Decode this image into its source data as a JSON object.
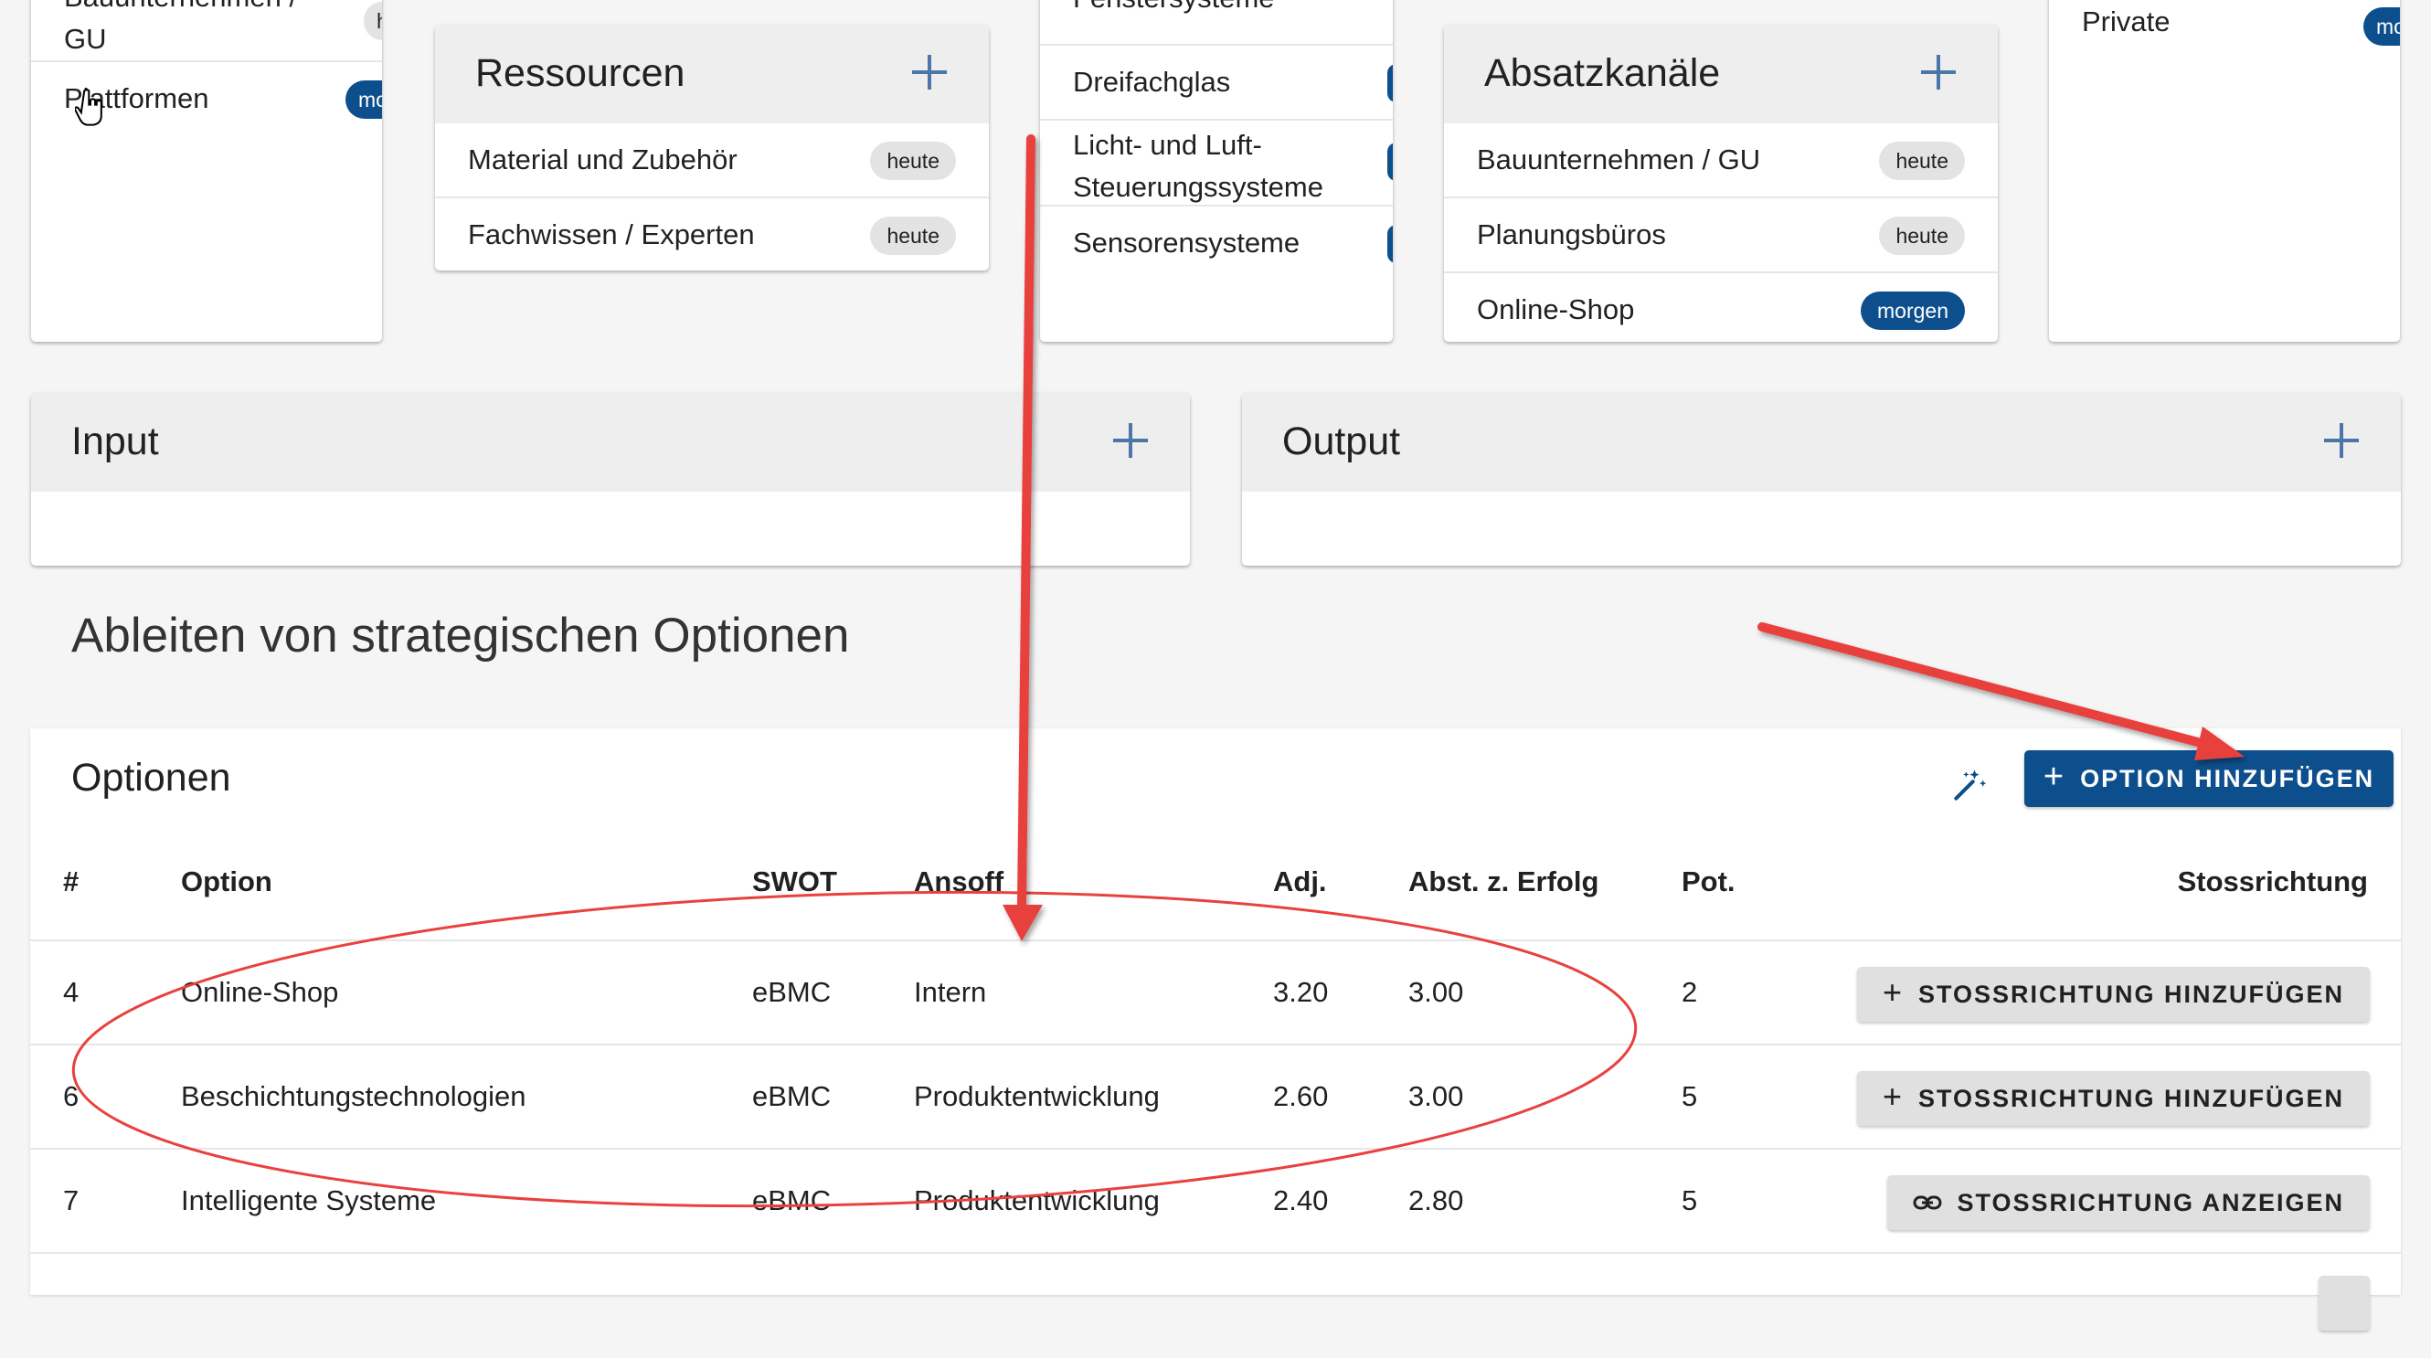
{
  "top_cards": {
    "partners": {
      "items": [
        {
          "label": "Bauunternehmen / GU",
          "chip": ""
        },
        {
          "label": "Plattformen",
          "chip": "morgen"
        }
      ]
    },
    "ressourcen": {
      "title": "Ressourcen",
      "items": [
        {
          "label": "Material und Zubehör",
          "chip": "heute"
        },
        {
          "label": "Fachwissen / Experten",
          "chip": "heute"
        }
      ]
    },
    "angebot": {
      "items": [
        {
          "label": "Fenstersysteme"
        },
        {
          "label": "Dreifachglas"
        },
        {
          "label": "Licht- und Luft-Steuerungssysteme"
        },
        {
          "label": "Sensorensysteme"
        }
      ]
    },
    "absatzkanaele": {
      "title": "Absatzkanäle",
      "items": [
        {
          "label": "Bauunternehmen / GU",
          "chip": "heute"
        },
        {
          "label": "Planungsbüros",
          "chip": "heute"
        },
        {
          "label": "Online-Shop",
          "chip": "morgen"
        }
      ]
    },
    "kunden": {
      "items": [
        {
          "label": "Private",
          "chip": "morgen"
        }
      ]
    }
  },
  "io_cards": {
    "input": {
      "title": "Input"
    },
    "output": {
      "title": "Output"
    }
  },
  "section": {
    "title": "Ableiten von strategischen Optionen"
  },
  "options": {
    "title": "Optionen",
    "add_button": "OPTION HINZUFÜGEN",
    "columns": [
      "#",
      "Option",
      "SWOT",
      "Ansoff",
      "Adj.",
      "Abst. z. Erfolg",
      "Pot.",
      "Stossrichtung"
    ],
    "rows": [
      {
        "num": "4",
        "option": "Online-Shop",
        "swot": "eBMC",
        "ansoff": "Intern",
        "adj": "3.20",
        "abst": "3.00",
        "pot": "2",
        "action": "STOSSRICHTUNG HINZUFÜGEN",
        "action_icon": "plus-icon"
      },
      {
        "num": "6",
        "option": "Beschichtungstechnologien",
        "swot": "eBMC",
        "ansoff": "Produktentwicklung",
        "adj": "2.60",
        "abst": "3.00",
        "pot": "5",
        "action": "STOSSRICHTUNG HINZUFÜGEN",
        "action_icon": "plus-icon"
      },
      {
        "num": "7",
        "option": "Intelligente Systeme",
        "swot": "eBMC",
        "ansoff": "Produktentwicklung",
        "adj": "2.40",
        "abst": "2.80",
        "pot": "5",
        "action": "STOSSRICHTUNG ANZEIGEN",
        "action_icon": "link-icon"
      }
    ]
  },
  "colors": {
    "primary": "#0d4f8c",
    "accent_plus": "#4a76a8",
    "annotation": "#e8413e"
  }
}
